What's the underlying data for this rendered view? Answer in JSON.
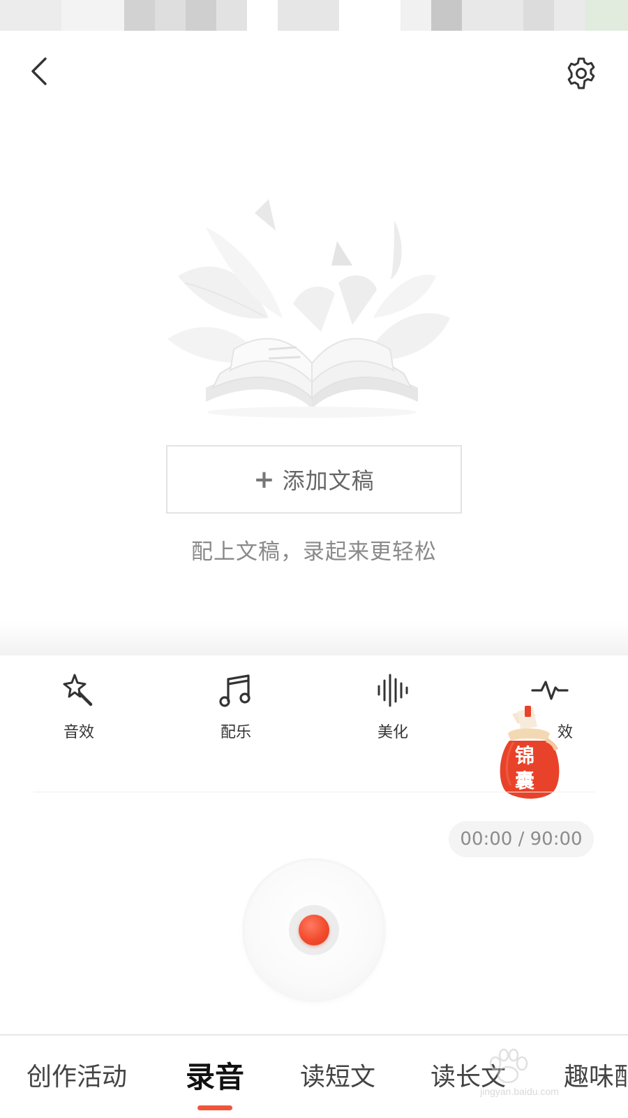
{
  "header": {
    "back_icon": "chevron-left-icon",
    "settings_icon": "gear-icon"
  },
  "script": {
    "add_button_icon": "+",
    "add_button_label": "添加文稿",
    "hint": "配上文稿，录起来更轻松"
  },
  "tools": [
    {
      "label": "音效",
      "icon": "magic-wand-icon"
    },
    {
      "label": "配乐",
      "icon": "music-note-icon"
    },
    {
      "label": "美化",
      "icon": "waveform-icon"
    },
    {
      "label": "特效",
      "icon": "pulse-icon",
      "visible_label": "效"
    }
  ],
  "badge": {
    "line1": "锦",
    "line2": "囊",
    "color": "#e8432a"
  },
  "recorder": {
    "timer": "00:00 / 90:00",
    "record_color": "#f24b2d"
  },
  "bottom_nav": {
    "items": [
      "创作活动",
      "录音",
      "读短文",
      "读长文",
      "趣味配"
    ],
    "active_index": 1,
    "accent_color": "#f0553a"
  },
  "watermark": {
    "text": "jingyan.baidu.com"
  }
}
